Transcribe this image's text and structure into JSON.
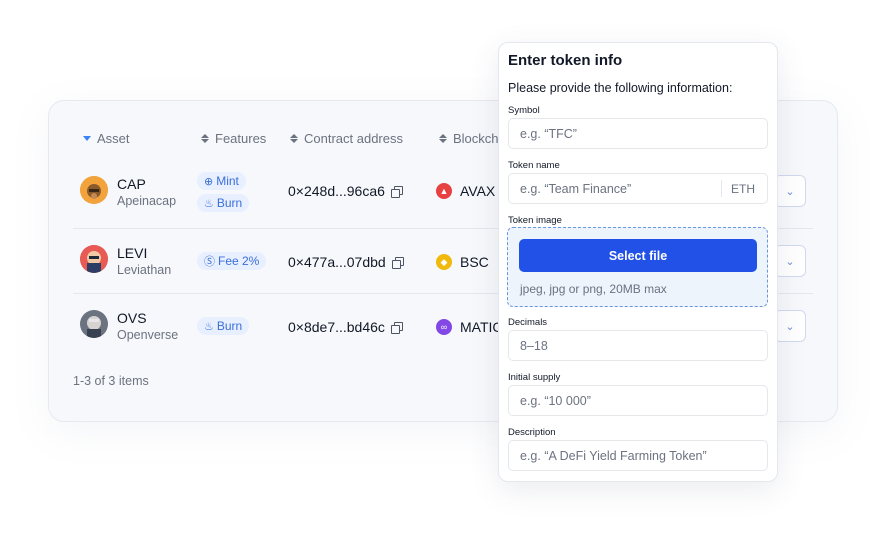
{
  "table": {
    "headers": {
      "asset": "Asset",
      "features": "Features",
      "contract": "Contract address",
      "blockchain": "Blockch"
    },
    "rows": [
      {
        "symbol": "CAP",
        "name": "Apeinacap",
        "features": [
          {
            "icon": "plus-circle-icon",
            "label": "Mint"
          },
          {
            "icon": "flame-icon",
            "label": "Burn"
          }
        ],
        "address": "0×248d...96ca6",
        "chain": "AVAX",
        "chain_color": "#e84142"
      },
      {
        "symbol": "LEVI",
        "name": "Leviathan",
        "features": [
          {
            "icon": "dollar-circle-icon",
            "label": "Fee 2%"
          }
        ],
        "address": "0×477a...07dbd",
        "chain": "BSC",
        "chain_color": "#f0b90b"
      },
      {
        "symbol": "OVS",
        "name": "Openverse",
        "features": [
          {
            "icon": "flame-icon",
            "label": "Burn"
          }
        ],
        "address": "0×8de7...bd46c",
        "chain": "MATIC",
        "chain_color": "#8247e5"
      }
    ],
    "footer": "1-3 of 3 items"
  },
  "modal": {
    "title": "Enter token info",
    "subtitle": "Please provide the following information:",
    "fields": {
      "symbol": {
        "label": "Symbol",
        "placeholder": "e.g. “TFC”"
      },
      "token_name": {
        "label": "Token name",
        "placeholder": "e.g. “Team Finance”",
        "suffix": "ETH"
      },
      "token_image": {
        "label": "Token image",
        "button": "Select file",
        "hint": "jpeg, jpg or png, 20MB max"
      },
      "decimals": {
        "label": "Decimals",
        "placeholder": "8–18"
      },
      "initial_supply": {
        "label": "Initial supply",
        "placeholder": "e.g. “10 000”"
      },
      "description": {
        "label": "Description",
        "placeholder": "e.g. “A DeFi Yield Farming Token”"
      }
    }
  },
  "colors": {
    "accent": "#2251e8",
    "badge_bg": "#e8efff",
    "badge_text": "#3b6fd8"
  }
}
